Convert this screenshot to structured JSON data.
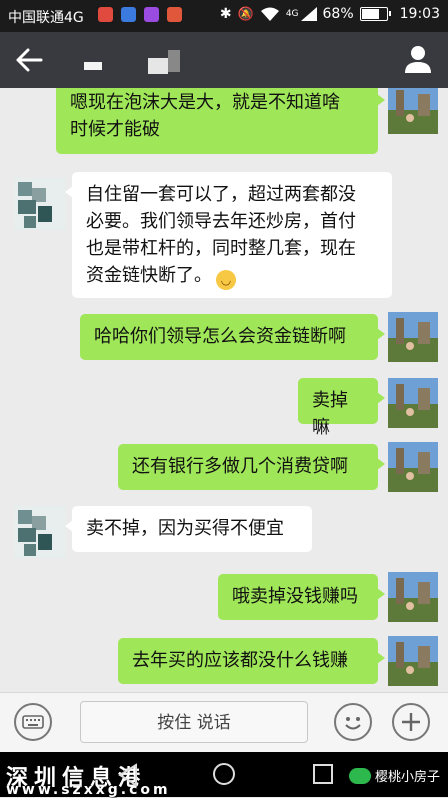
{
  "status_bar": {
    "carrier": "中国联通4G",
    "network": "4G",
    "battery": "68%",
    "time": "19:03"
  },
  "input_bar": {
    "hold_to_talk": "按住 说话"
  },
  "messages": [
    {
      "side": "me",
      "text_lines": [
        "嗯现在泡沫大是大，就是不知道啥",
        "时候才能破"
      ]
    },
    {
      "side": "other",
      "text_lines": [
        "自住留一套可以了，超过两套都没",
        "必要。我们领导去年还炒房，首付",
        "也是带杠杆的，同时整几套，现在",
        "资金链快断了。"
      ]
    },
    {
      "side": "me",
      "text_lines": [
        "哈哈你们领导怎么会资金链断啊"
      ]
    },
    {
      "side": "me",
      "text_lines": [
        "卖掉嘛"
      ]
    },
    {
      "side": "me",
      "text_lines": [
        "还有银行多做几个消费贷啊"
      ]
    },
    {
      "side": "other",
      "text_lines": [
        "卖不掉，因为买得不便宜"
      ]
    },
    {
      "side": "me",
      "text_lines": [
        "哦卖掉没钱赚吗"
      ]
    },
    {
      "side": "me",
      "text_lines": [
        "去年买的应该都没什么钱赚"
      ]
    }
  ],
  "watermark": {
    "left": "深圳信息港",
    "url": "www.szxxg.com",
    "right": "樱桃小房子"
  },
  "icons": {
    "back": "arrow-left-icon",
    "profile": "person-icon",
    "keyboard": "keyboard-icon",
    "emoji": "smiley-icon",
    "add": "plus-icon",
    "nav_back": "triangle-back-icon",
    "nav_home": "circle-home-icon",
    "nav_recent": "square-recent-icon"
  }
}
